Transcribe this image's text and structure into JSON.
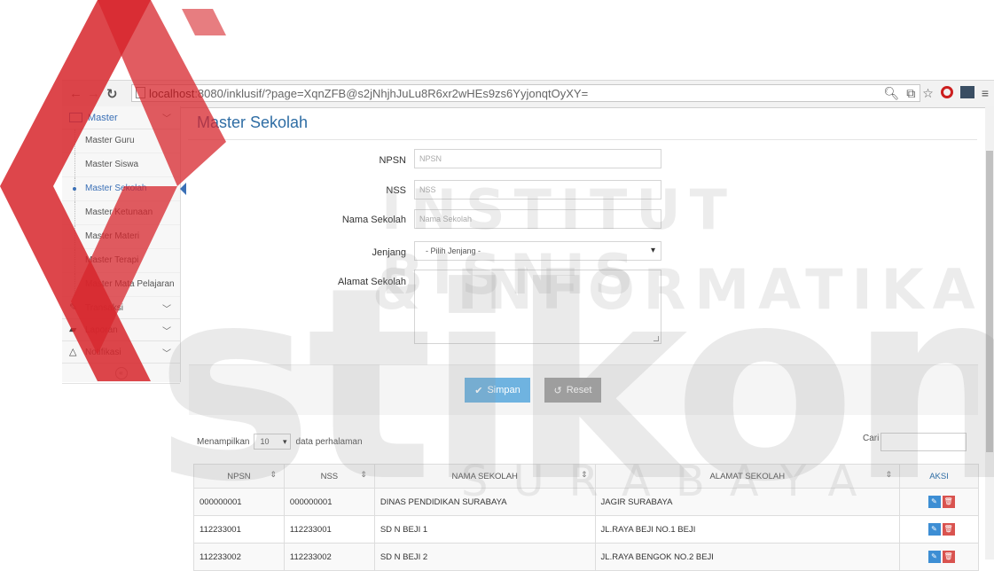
{
  "browser": {
    "url_host": "localhost",
    "url_rest": ":8080/inklusif/?page=XqnZFB@s2jNhjhJuLu8R6xr2wHEs9zs6YyjonqtOyXY="
  },
  "sidebar": {
    "master_label": "Master",
    "master_items": [
      {
        "label": "Master Guru"
      },
      {
        "label": "Master Siswa"
      },
      {
        "label": "Master Sekolah"
      },
      {
        "label": "Master Ketunaan"
      },
      {
        "label": "Master Materi"
      },
      {
        "label": "Master Terapi"
      },
      {
        "label": "Master Mata Pelajaran"
      }
    ],
    "groups": [
      {
        "label": "Transaksi"
      },
      {
        "label": "Laporan"
      },
      {
        "label": "Notifikasi"
      }
    ],
    "collapse_icon": "«"
  },
  "page": {
    "title": "Master Sekolah"
  },
  "form": {
    "npsn_label": "NPSN",
    "npsn_placeholder": "NPSN",
    "nss_label": "NSS",
    "nss_placeholder": "NSS",
    "nama_label": "Nama Sekolah",
    "nama_placeholder": "Nama Sekolah",
    "jenjang_label": "Jenjang",
    "jenjang_value": "- Pilih Jenjang -",
    "alamat_label": "Alamat Sekolah",
    "save_label": "Simpan",
    "reset_label": "Reset"
  },
  "table_controls": {
    "show_prefix": "Menampilkan",
    "page_size": "10",
    "show_suffix": "data perhalaman",
    "search_label": "Cari"
  },
  "table": {
    "headers": [
      "NPSN",
      "NSS",
      "NAMA SEKOLAH",
      "ALAMAT SEKOLAH",
      "AKSI"
    ],
    "rows": [
      {
        "npsn": "000000001",
        "nss": "000000001",
        "nama": "DINAS PENDIDIKAN SURABAYA",
        "alamat": "JAGIR SURABAYA"
      },
      {
        "npsn": "112233001",
        "nss": "112233001",
        "nama": "SD N BEJI 1",
        "alamat": "JL.RAYA BEJI NO.1 BEJI"
      },
      {
        "npsn": "112233002",
        "nss": "112233002",
        "nama": "SD N BEJI 2",
        "alamat": "JL.RAYA BENGOK NO.2 BEJI"
      }
    ]
  },
  "watermark": {
    "line1": "INSTITUT BISNIS",
    "line2": "& INFORMATIKA",
    "logo": "stikom",
    "line3": "SURABAYA"
  },
  "colors": {
    "accent": "#2e6da4",
    "save_button": "#6fb3e0",
    "reset_button": "#a0a0a0",
    "edit_button": "#3d8ed4",
    "delete_button": "#d9534f",
    "logo_red": "#d7262c"
  }
}
